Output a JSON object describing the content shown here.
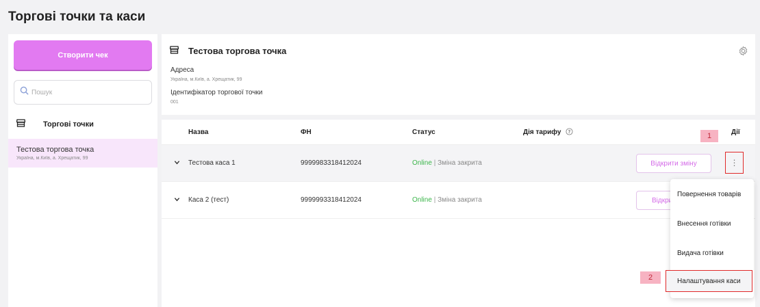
{
  "page": {
    "title": "Торгові точки та каси"
  },
  "sidebar": {
    "create_label": "Створити чек",
    "search_placeholder": "Пошук",
    "heading": "Торгові точки",
    "items": [
      {
        "name": "Тестова торгова точка",
        "address": "Україна, м.Київ, а. Хрещатик, 99"
      }
    ]
  },
  "store": {
    "title": "Тестова торгова точка",
    "address_label": "Адреса",
    "address_value": "Україна, м.Київ, а. Хрещатик, 99",
    "id_label": "Ідентифікатор торгової точки",
    "id_value": "001"
  },
  "table": {
    "headers": {
      "name": "Назва",
      "fn": "ФН",
      "status": "Статус",
      "tariff": "Дія тарифу",
      "actions": "Дії"
    },
    "rows": [
      {
        "name": "Тестова каса 1",
        "fn": "9999983318412024",
        "online": "Online",
        "sep": "|",
        "shift": "Зміна закрита",
        "action": "Відкрити зміну"
      },
      {
        "name": "Каса 2 (тест)",
        "fn": "9999993318412024",
        "online": "Online",
        "sep": "|",
        "shift": "Зміна закрита",
        "action": "Відкри"
      }
    ]
  },
  "menu": {
    "items": [
      "Повернення товарів",
      "Внесення готівки",
      "Видача готівки",
      "Налаштування каси"
    ]
  },
  "markers": [
    "1",
    "2"
  ],
  "colors": {
    "accent": "#e27af1",
    "online": "#3bb54a",
    "highlight_border": "#e02828",
    "selected_bg": "#f8e6fb"
  },
  "icons": {
    "store": "store-icon",
    "search": "search-icon",
    "gear": "gear-icon",
    "info": "info-icon",
    "chevron": "chevron-down-icon",
    "more": "more-vertical-icon"
  }
}
